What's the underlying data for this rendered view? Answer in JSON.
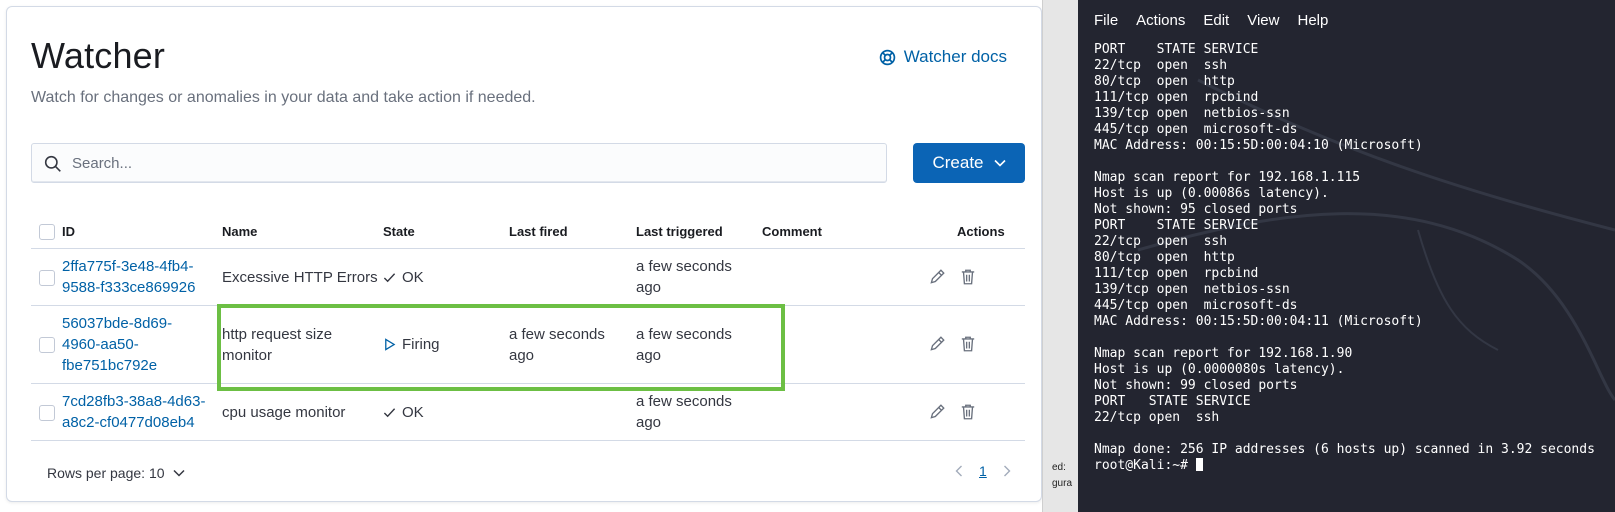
{
  "watcher": {
    "title": "Watcher",
    "subtitle": "Watch for changes or anomalies in your data and take action if needed.",
    "docs_link": "Watcher docs",
    "search_placeholder": "Search...",
    "create_label": "Create",
    "columns": {
      "id": "ID",
      "name": "Name",
      "state": "State",
      "last_fired": "Last fired",
      "last_triggered": "Last triggered",
      "comment": "Comment",
      "actions": "Actions"
    },
    "rows": [
      {
        "id_line1": "2ffa775f-3e48-4fb4-",
        "id_line2": "9588-f333ce869926",
        "name_line1": "Excessive HTTP Errors",
        "name_line2": "",
        "state": "OK",
        "last_fired_line1": "",
        "last_fired_line2": "",
        "last_triggered_line1": "a few seconds",
        "last_triggered_line2": "ago"
      },
      {
        "id_line1": "56037bde-8d69-",
        "id_line2": "4960-aa50-",
        "id_line3": "fbe751bc792e",
        "name_line1": "http request size",
        "name_line2": "monitor",
        "state": "Firing",
        "last_fired_line1": "a few seconds",
        "last_fired_line2": "ago",
        "last_triggered_line1": "a few seconds",
        "last_triggered_line2": "ago"
      },
      {
        "id_line1": "7cd28fb3-38a8-4d63-",
        "id_line2": "a8c2-cf0477d08eb4",
        "name_line1": "cpu usage monitor",
        "name_line2": "",
        "state": "OK",
        "last_fired_line1": "",
        "last_fired_line2": "",
        "last_triggered_line1": "a few seconds",
        "last_triggered_line2": "ago"
      }
    ],
    "rows_per_page": "Rows per page: 10",
    "current_page": "1"
  },
  "side_strip": {
    "text1": "ed:",
    "text2": "gura"
  },
  "terminal": {
    "menu": [
      "File",
      "Actions",
      "Edit",
      "View",
      "Help"
    ],
    "lines": [
      "PORT    STATE SERVICE",
      "22/tcp  open  ssh",
      "80/tcp  open  http",
      "111/tcp open  rpcbind",
      "139/tcp open  netbios-ssn",
      "445/tcp open  microsoft-ds",
      "MAC Address: 00:15:5D:00:04:10 (Microsoft)",
      "",
      "Nmap scan report for 192.168.1.115",
      "Host is up (0.00086s latency).",
      "Not shown: 95 closed ports",
      "PORT    STATE SERVICE",
      "22/tcp  open  ssh",
      "80/tcp  open  http",
      "111/tcp open  rpcbind",
      "139/tcp open  netbios-ssn",
      "445/tcp open  microsoft-ds",
      "MAC Address: 00:15:5D:00:04:11 (Microsoft)",
      "",
      "Nmap scan report for 192.168.1.90",
      "Host is up (0.0000080s latency).",
      "Not shown: 99 closed ports",
      "PORT   STATE SERVICE",
      "22/tcp open  ssh",
      "",
      "Nmap done: 256 IP addresses (6 hosts up) scanned in 3.92 seconds"
    ],
    "prompt": "root@Kali:~# "
  }
}
